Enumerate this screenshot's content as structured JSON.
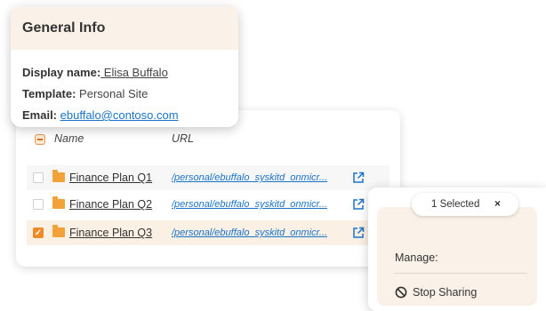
{
  "general_info": {
    "title": "General Info",
    "display_name_label": "Display name:",
    "display_name_value": " Elisa Buffalo",
    "template_label": "Template:",
    "template_value": " Personal Site",
    "email_label": "Email:",
    "email_value": "ebuffalo@contoso.com"
  },
  "table": {
    "columns": [
      "Name",
      "URL"
    ],
    "rows": [
      {
        "name": "Finance Plan Q1",
        "url": "/personal/ebuffalo_syskitd_onmicr...",
        "checked": false
      },
      {
        "name": "Finance Plan Q2",
        "url": "/personal/ebuffalo_syskitd_onmicr...",
        "checked": false
      },
      {
        "name": "Finance Plan Q3",
        "url": "/personal/ebuffalo_syskitd_onmicr...",
        "checked": true
      }
    ]
  },
  "selection": {
    "label": "1 Selected",
    "close": "×",
    "manage_label": "Manage:",
    "stop_sharing": "Stop Sharing"
  },
  "colors": {
    "accent": "#f08a24",
    "header_bg": "#faf2e8",
    "link": "#1a73c7"
  },
  "icons": [
    "folder-icon",
    "external-link-icon",
    "stop-icon",
    "checkbox-checked-icon"
  ]
}
